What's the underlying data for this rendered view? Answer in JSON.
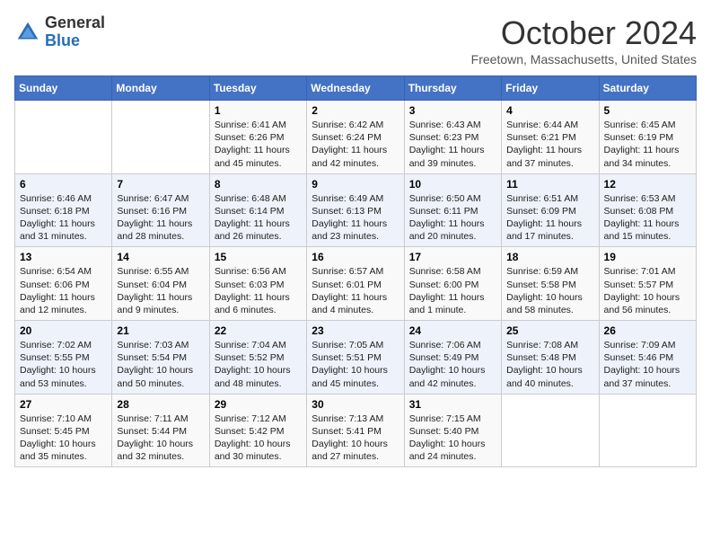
{
  "header": {
    "logo_general": "General",
    "logo_blue": "Blue",
    "month_title": "October 2024",
    "location": "Freetown, Massachusetts, United States"
  },
  "days_of_week": [
    "Sunday",
    "Monday",
    "Tuesday",
    "Wednesday",
    "Thursday",
    "Friday",
    "Saturday"
  ],
  "weeks": [
    [
      {
        "day": "",
        "sunrise": "",
        "sunset": "",
        "daylight": ""
      },
      {
        "day": "",
        "sunrise": "",
        "sunset": "",
        "daylight": ""
      },
      {
        "day": "1",
        "sunrise": "Sunrise: 6:41 AM",
        "sunset": "Sunset: 6:26 PM",
        "daylight": "Daylight: 11 hours and 45 minutes."
      },
      {
        "day": "2",
        "sunrise": "Sunrise: 6:42 AM",
        "sunset": "Sunset: 6:24 PM",
        "daylight": "Daylight: 11 hours and 42 minutes."
      },
      {
        "day": "3",
        "sunrise": "Sunrise: 6:43 AM",
        "sunset": "Sunset: 6:23 PM",
        "daylight": "Daylight: 11 hours and 39 minutes."
      },
      {
        "day": "4",
        "sunrise": "Sunrise: 6:44 AM",
        "sunset": "Sunset: 6:21 PM",
        "daylight": "Daylight: 11 hours and 37 minutes."
      },
      {
        "day": "5",
        "sunrise": "Sunrise: 6:45 AM",
        "sunset": "Sunset: 6:19 PM",
        "daylight": "Daylight: 11 hours and 34 minutes."
      }
    ],
    [
      {
        "day": "6",
        "sunrise": "Sunrise: 6:46 AM",
        "sunset": "Sunset: 6:18 PM",
        "daylight": "Daylight: 11 hours and 31 minutes."
      },
      {
        "day": "7",
        "sunrise": "Sunrise: 6:47 AM",
        "sunset": "Sunset: 6:16 PM",
        "daylight": "Daylight: 11 hours and 28 minutes."
      },
      {
        "day": "8",
        "sunrise": "Sunrise: 6:48 AM",
        "sunset": "Sunset: 6:14 PM",
        "daylight": "Daylight: 11 hours and 26 minutes."
      },
      {
        "day": "9",
        "sunrise": "Sunrise: 6:49 AM",
        "sunset": "Sunset: 6:13 PM",
        "daylight": "Daylight: 11 hours and 23 minutes."
      },
      {
        "day": "10",
        "sunrise": "Sunrise: 6:50 AM",
        "sunset": "Sunset: 6:11 PM",
        "daylight": "Daylight: 11 hours and 20 minutes."
      },
      {
        "day": "11",
        "sunrise": "Sunrise: 6:51 AM",
        "sunset": "Sunset: 6:09 PM",
        "daylight": "Daylight: 11 hours and 17 minutes."
      },
      {
        "day": "12",
        "sunrise": "Sunrise: 6:53 AM",
        "sunset": "Sunset: 6:08 PM",
        "daylight": "Daylight: 11 hours and 15 minutes."
      }
    ],
    [
      {
        "day": "13",
        "sunrise": "Sunrise: 6:54 AM",
        "sunset": "Sunset: 6:06 PM",
        "daylight": "Daylight: 11 hours and 12 minutes."
      },
      {
        "day": "14",
        "sunrise": "Sunrise: 6:55 AM",
        "sunset": "Sunset: 6:04 PM",
        "daylight": "Daylight: 11 hours and 9 minutes."
      },
      {
        "day": "15",
        "sunrise": "Sunrise: 6:56 AM",
        "sunset": "Sunset: 6:03 PM",
        "daylight": "Daylight: 11 hours and 6 minutes."
      },
      {
        "day": "16",
        "sunrise": "Sunrise: 6:57 AM",
        "sunset": "Sunset: 6:01 PM",
        "daylight": "Daylight: 11 hours and 4 minutes."
      },
      {
        "day": "17",
        "sunrise": "Sunrise: 6:58 AM",
        "sunset": "Sunset: 6:00 PM",
        "daylight": "Daylight: 11 hours and 1 minute."
      },
      {
        "day": "18",
        "sunrise": "Sunrise: 6:59 AM",
        "sunset": "Sunset: 5:58 PM",
        "daylight": "Daylight: 10 hours and 58 minutes."
      },
      {
        "day": "19",
        "sunrise": "Sunrise: 7:01 AM",
        "sunset": "Sunset: 5:57 PM",
        "daylight": "Daylight: 10 hours and 56 minutes."
      }
    ],
    [
      {
        "day": "20",
        "sunrise": "Sunrise: 7:02 AM",
        "sunset": "Sunset: 5:55 PM",
        "daylight": "Daylight: 10 hours and 53 minutes."
      },
      {
        "day": "21",
        "sunrise": "Sunrise: 7:03 AM",
        "sunset": "Sunset: 5:54 PM",
        "daylight": "Daylight: 10 hours and 50 minutes."
      },
      {
        "day": "22",
        "sunrise": "Sunrise: 7:04 AM",
        "sunset": "Sunset: 5:52 PM",
        "daylight": "Daylight: 10 hours and 48 minutes."
      },
      {
        "day": "23",
        "sunrise": "Sunrise: 7:05 AM",
        "sunset": "Sunset: 5:51 PM",
        "daylight": "Daylight: 10 hours and 45 minutes."
      },
      {
        "day": "24",
        "sunrise": "Sunrise: 7:06 AM",
        "sunset": "Sunset: 5:49 PM",
        "daylight": "Daylight: 10 hours and 42 minutes."
      },
      {
        "day": "25",
        "sunrise": "Sunrise: 7:08 AM",
        "sunset": "Sunset: 5:48 PM",
        "daylight": "Daylight: 10 hours and 40 minutes."
      },
      {
        "day": "26",
        "sunrise": "Sunrise: 7:09 AM",
        "sunset": "Sunset: 5:46 PM",
        "daylight": "Daylight: 10 hours and 37 minutes."
      }
    ],
    [
      {
        "day": "27",
        "sunrise": "Sunrise: 7:10 AM",
        "sunset": "Sunset: 5:45 PM",
        "daylight": "Daylight: 10 hours and 35 minutes."
      },
      {
        "day": "28",
        "sunrise": "Sunrise: 7:11 AM",
        "sunset": "Sunset: 5:44 PM",
        "daylight": "Daylight: 10 hours and 32 minutes."
      },
      {
        "day": "29",
        "sunrise": "Sunrise: 7:12 AM",
        "sunset": "Sunset: 5:42 PM",
        "daylight": "Daylight: 10 hours and 30 minutes."
      },
      {
        "day": "30",
        "sunrise": "Sunrise: 7:13 AM",
        "sunset": "Sunset: 5:41 PM",
        "daylight": "Daylight: 10 hours and 27 minutes."
      },
      {
        "day": "31",
        "sunrise": "Sunrise: 7:15 AM",
        "sunset": "Sunset: 5:40 PM",
        "daylight": "Daylight: 10 hours and 24 minutes."
      },
      {
        "day": "",
        "sunrise": "",
        "sunset": "",
        "daylight": ""
      },
      {
        "day": "",
        "sunrise": "",
        "sunset": "",
        "daylight": ""
      }
    ]
  ]
}
